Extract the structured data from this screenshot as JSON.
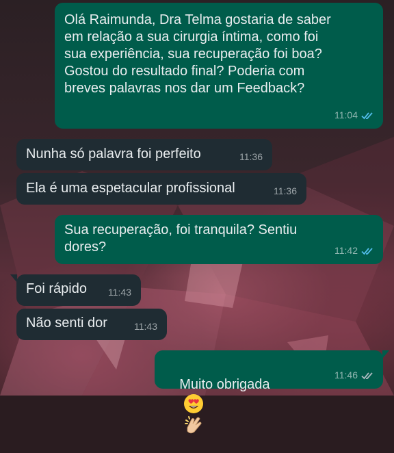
{
  "messages": [
    {
      "dir": "out",
      "text": "Olá Raimunda, Dra Telma gostaria de saber\nem relação a sua cirurgia íntima, como foi\nsua experiência, sua recuperação foi boa?\nGostou do resultado final? Poderia com\nbreves palavras nos dar um Feedback?",
      "time": "11:04",
      "status": "read"
    },
    {
      "dir": "in",
      "text": "Nunha só palavra foi perfeito",
      "time": "11:36"
    },
    {
      "dir": "in",
      "text": "Ela é uma espetacular profissional",
      "time": "11:36"
    },
    {
      "dir": "out",
      "text": "Sua recuperação, foi tranquila? Sentiu\ndores?",
      "time": "11:42",
      "status": "read"
    },
    {
      "dir": "in",
      "text": "Foi rápido",
      "time": "11:43"
    },
    {
      "dir": "in",
      "text": "Não senti dor",
      "time": "11:43"
    },
    {
      "dir": "out",
      "text": "Muito obrigada",
      "emojis": [
        "heart-eyes-emoji",
        "clapping-hands-emoji"
      ],
      "time": "11:46",
      "status": "delivered"
    }
  ],
  "colors": {
    "outgoing_bubble": "#005c4b",
    "incoming_bubble": "#1f2c33",
    "read_ticks": "#53bdeb",
    "delivered_ticks": "#aebac1"
  }
}
